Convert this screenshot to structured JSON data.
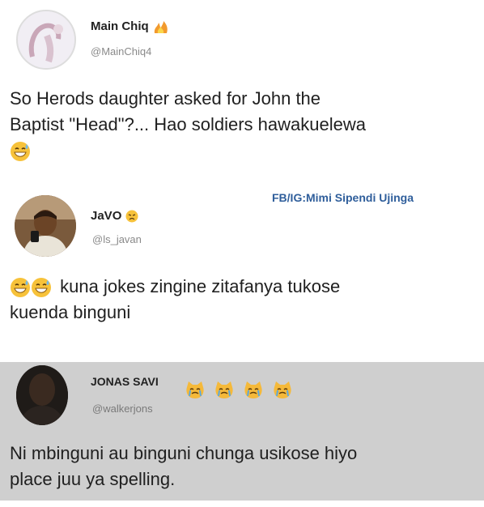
{
  "post1": {
    "name": "Main Chiq",
    "handle": "@MainChiq4",
    "text_line1": "So Herods daughter asked for John the",
    "text_line2": "Baptist \"Head\"?... Hao soldiers hawakuelewa"
  },
  "watermark": "FB/IG:Mimi Sipendi Ujinga",
  "post2": {
    "name": "JaVO",
    "handle": "@ls_javan",
    "text_line1": "kuna jokes zingine zitafanya tukose",
    "text_line2": "kuenda binguni"
  },
  "post3": {
    "name": "JONAS SAVI",
    "handle": "@walkerjons",
    "text_line1": "Ni mbinguni au binguni chunga usikose hiyo",
    "text_line2": "place juu ya spelling."
  },
  "colors": {
    "gray_background": "#cfcfcf",
    "watermark_blue": "#2f5e9b",
    "emoji_yellow": "#f7c23a"
  },
  "icons": [
    "fire-emoji-icon",
    "sweat-smile-emoji-icon",
    "disappointed-emoji-icon",
    "crying-cat-emoji-icon"
  ]
}
